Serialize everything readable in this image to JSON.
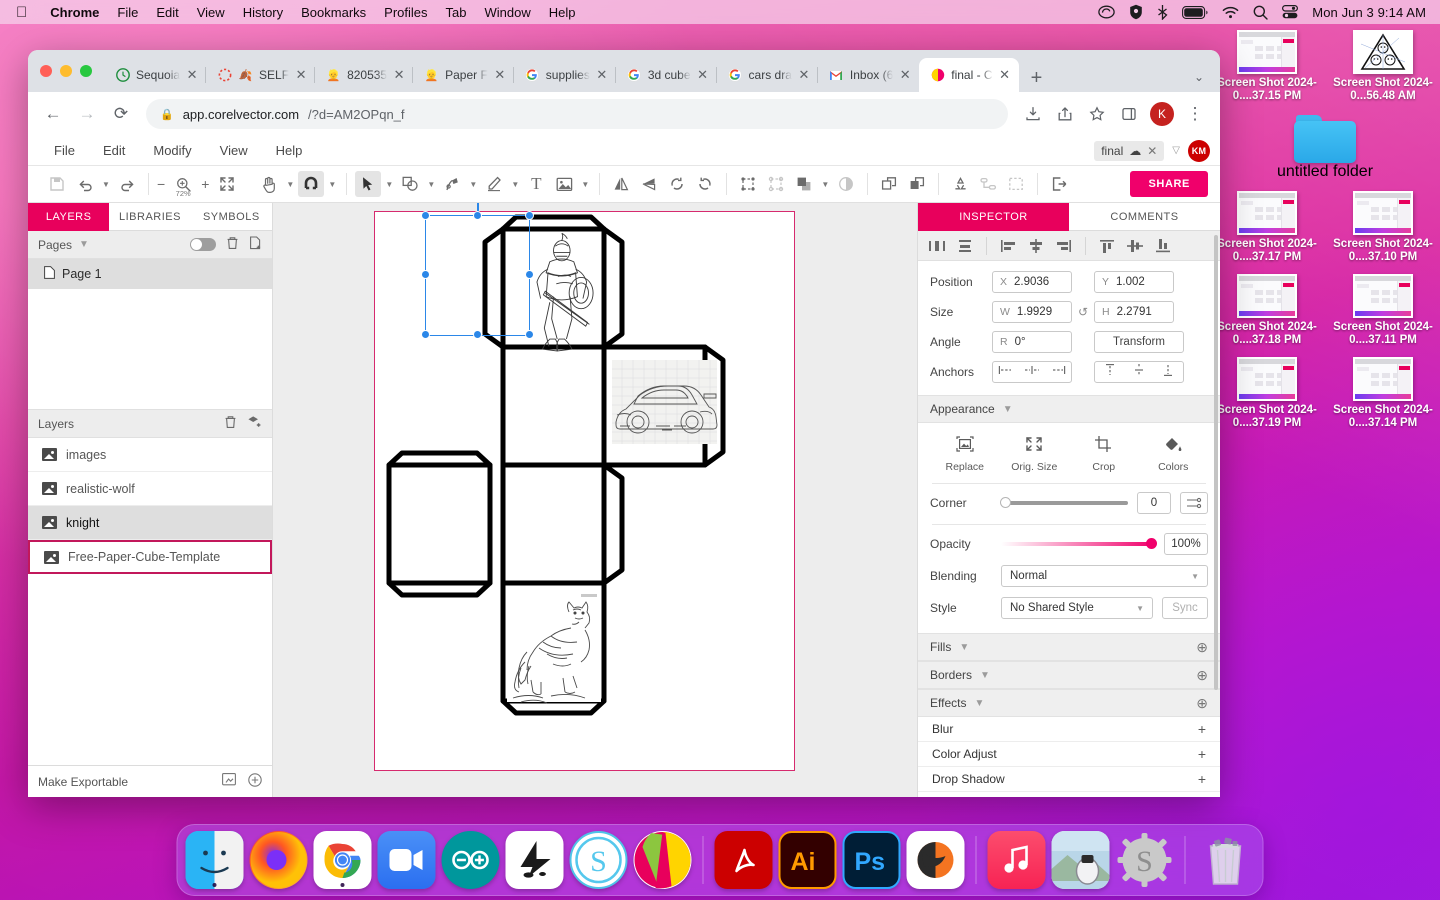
{
  "menubar": {
    "apple_icon": "apple-logo",
    "items": [
      {
        "label": "Chrome",
        "bold": true
      },
      {
        "label": "File",
        "bold": false
      },
      {
        "label": "Edit",
        "bold": false
      },
      {
        "label": "View",
        "bold": false
      },
      {
        "label": "History",
        "bold": false
      },
      {
        "label": "Bookmarks",
        "bold": false
      },
      {
        "label": "Profiles",
        "bold": false
      },
      {
        "label": "Tab",
        "bold": false
      },
      {
        "label": "Window",
        "bold": false
      },
      {
        "label": "Help",
        "bold": false
      }
    ],
    "status_icons": [
      "creative-cloud-icon",
      "shield-icon",
      "bluetooth-icon",
      "battery-icon",
      "wifi-icon",
      "search-icon",
      "control-center-icon"
    ],
    "clock": "Mon Jun 3  9:14 AM"
  },
  "desktop": {
    "icons": [
      {
        "label": "Screen Shot 2024-0....37.15 PM",
        "type": "screenshot"
      },
      {
        "label": "Screen Shot 2024-0...56.48 AM",
        "type": "triangle"
      },
      {
        "label": "untitled folder",
        "type": "folder"
      },
      {
        "label": "Screen Shot 2024-0....37.17 PM",
        "type": "screenshot"
      },
      {
        "label": "Screen Shot 2024-0....37.10 PM",
        "type": "screenshot"
      },
      {
        "label": "Screen Shot 2024-0....37.18 PM",
        "type": "screenshot"
      },
      {
        "label": "Screen Shot 2024-0....37.11 PM",
        "type": "screenshot"
      },
      {
        "label": "Screen Shot 2024-0....37.19 PM",
        "type": "screenshot"
      },
      {
        "label": "Screen Shot 2024-0....37.14 PM",
        "type": "screenshot"
      }
    ]
  },
  "browser": {
    "tabs": [
      {
        "title": "Sequoia",
        "favicon": "clock-icon",
        "active": false
      },
      {
        "title": "SELF",
        "favicon": "red-dotted-circle-icon",
        "active": false
      },
      {
        "title": "820535",
        "favicon": "person-icon",
        "active": false
      },
      {
        "title": "Paper F",
        "favicon": "person-icon",
        "active": false
      },
      {
        "title": "supplies",
        "favicon": "google-icon",
        "active": false
      },
      {
        "title": "3d cube",
        "favicon": "google-icon",
        "active": false
      },
      {
        "title": "cars dra",
        "favicon": "google-icon",
        "active": false
      },
      {
        "title": "Inbox (6",
        "favicon": "gmail-icon",
        "active": false
      },
      {
        "title": "final - C",
        "favicon": "corel-icon",
        "active": true
      }
    ],
    "new_tab_label": "+",
    "tab_list_caret": "⌄",
    "url_host": "app.corelvector.com",
    "url_path": "/?d=AM2OPqn_f",
    "nav": {
      "back": "←",
      "forward": "→",
      "reload": "⟳"
    },
    "profile_initial": "K"
  },
  "app": {
    "menu": [
      "File",
      "Edit",
      "Modify",
      "View",
      "Help"
    ],
    "doc_chip": "final",
    "user_initials": "KM",
    "toolbar": {
      "zoom_level": "72%",
      "share_label": "SHARE",
      "icons": [
        "save-icon",
        "undo-icon",
        "redo-icon",
        "zoom-icon",
        "fit-icon",
        "hand-tool-icon",
        "magnet-snap-icon",
        "select-tool-icon",
        "shape-tool-icon",
        "pen-tool-icon",
        "pencil-tool-icon",
        "text-tool-icon",
        "image-tool-icon",
        "flip-horizontal-icon",
        "flip-vertical-icon",
        "rotate-ccw-icon",
        "rotate-cw-icon",
        "group-icon",
        "ungroup-icon",
        "boolean-icon",
        "mask-icon",
        "bring-forward-icon",
        "send-backward-icon",
        "recycle-icon",
        "path-icon",
        "marquee-icon",
        "export-icon"
      ]
    },
    "left_panel": {
      "tabs": [
        {
          "label": "LAYERS",
          "active": true
        },
        {
          "label": "LIBRARIES",
          "active": false
        },
        {
          "label": "SYMBOLS",
          "active": false
        }
      ],
      "pages_header": "Pages",
      "pages": [
        {
          "label": "Page 1",
          "selected": true
        }
      ],
      "layers_header": "Layers",
      "layers": [
        {
          "label": "images",
          "selected": false,
          "outlined": false
        },
        {
          "label": "realistic-wolf",
          "selected": false,
          "outlined": false
        },
        {
          "label": "knight",
          "selected": true,
          "outlined": false
        },
        {
          "label": "Free-Paper-Cube-Template",
          "selected": false,
          "outlined": true
        }
      ],
      "footer_label": "Make Exportable"
    },
    "right_panel": {
      "tabs": [
        {
          "label": "INSPECTOR",
          "active": true
        },
        {
          "label": "COMMENTS",
          "active": false
        }
      ],
      "props": {
        "position_label": "Position",
        "position_x_prefix": "X",
        "position_x": "2.9036",
        "position_y_prefix": "Y",
        "position_y": "1.002",
        "size_label": "Size",
        "size_w_prefix": "W",
        "size_w": "1.9929",
        "size_h_prefix": "H",
        "size_h": "2.2791",
        "angle_label": "Angle",
        "angle_prefix": "R",
        "angle": "0°",
        "transform_label": "Transform",
        "anchors_label": "Anchors"
      },
      "appearance": {
        "header": "Appearance",
        "actions": [
          {
            "label": "Replace",
            "icon": "replace-image-icon"
          },
          {
            "label": "Orig. Size",
            "icon": "original-size-icon"
          },
          {
            "label": "Crop",
            "icon": "crop-icon"
          },
          {
            "label": "Colors",
            "icon": "paint-bucket-icon"
          }
        ],
        "corner_label": "Corner",
        "corner_value": "0",
        "opacity_label": "Opacity",
        "opacity_value": "100%",
        "blending_label": "Blending",
        "blending_value": "Normal",
        "style_label": "Style",
        "style_value": "No Shared Style",
        "sync_label": "Sync"
      },
      "sections": [
        {
          "label": "Fills"
        },
        {
          "label": "Borders"
        },
        {
          "label": "Effects"
        }
      ],
      "effects": [
        {
          "label": "Blur"
        },
        {
          "label": "Color Adjust"
        },
        {
          "label": "Drop Shadow"
        }
      ]
    },
    "canvas": {
      "artboard_name": "cube-net-artboard",
      "images": [
        "knight-drawing",
        "sports-car-drawing",
        "realistic-wolf-drawing"
      ]
    }
  },
  "dock": {
    "apps": [
      {
        "name": "finder",
        "running": true
      },
      {
        "name": "firefox",
        "running": false
      },
      {
        "name": "chrome",
        "running": true
      },
      {
        "name": "zoom",
        "running": false
      },
      {
        "name": "arduino",
        "running": false
      },
      {
        "name": "inkscape",
        "running": false
      },
      {
        "name": "skype",
        "running": false
      },
      {
        "name": "corel-painter",
        "running": false
      },
      {
        "name": "acrobat-reader",
        "running": false
      },
      {
        "name": "illustrator",
        "running": false
      },
      {
        "name": "photoshop",
        "running": false
      },
      {
        "name": "corel-vector",
        "running": false
      },
      {
        "name": "music",
        "running": false
      },
      {
        "name": "preview",
        "running": false
      },
      {
        "name": "settings",
        "running": false
      },
      {
        "name": "trash",
        "running": false
      }
    ]
  },
  "colors": {
    "accent_pink": "#e8005c",
    "share_pink": "#f0006b",
    "selection_blue": "#2b87e8",
    "artboard_border": "#d62a6e",
    "layer_outline": "#c2185b"
  }
}
